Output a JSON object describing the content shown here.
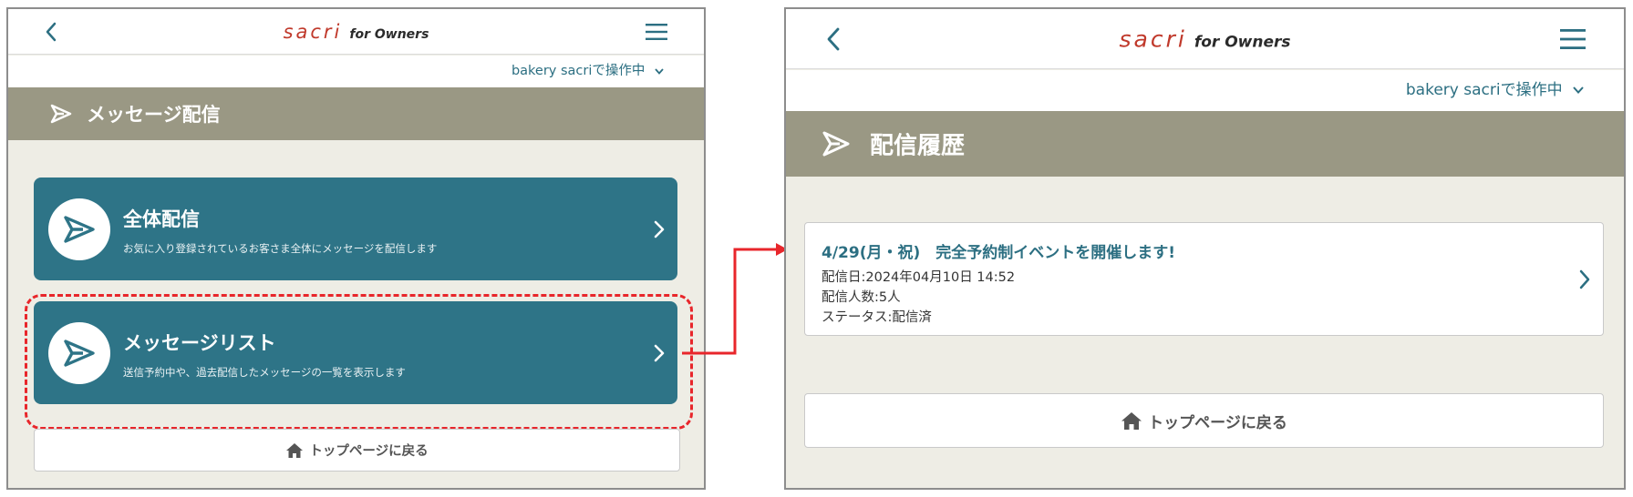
{
  "app": {
    "logo_main": "sacri",
    "logo_sub": "for Owners",
    "operator_label": "bakery sacriで操作中"
  },
  "left_screen": {
    "page_title": "メッセージ配信",
    "cards": [
      {
        "title": "全体配信",
        "description": "お気に入り登録されているお客さま全体にメッセージを配信します"
      },
      {
        "title": "メッセージリスト",
        "description": "送信予約中や、過去配信したメッセージの一覧を表示します"
      }
    ],
    "home_button": "トップページに戻る"
  },
  "right_screen": {
    "page_title": "配信履歴",
    "history_items": [
      {
        "title": "4/29(月・祝)　完全予約制イベントを開催します!",
        "date_line": "配信日:2024年04月10日 14:52",
        "count_line": "配信人数:5人",
        "status_line": "ステータス:配信済"
      }
    ],
    "home_button": "トップページに戻る"
  },
  "colors": {
    "teal": "#2e7487",
    "title_bar": "#9a9884",
    "background": "#eeede5",
    "logo_red": "#c0392b",
    "highlight_red": "#e8262b"
  },
  "icons": [
    "back-chevron-icon",
    "hamburger-menu-icon",
    "send-icon",
    "chevron-down-icon",
    "chevron-right-icon",
    "home-icon"
  ]
}
